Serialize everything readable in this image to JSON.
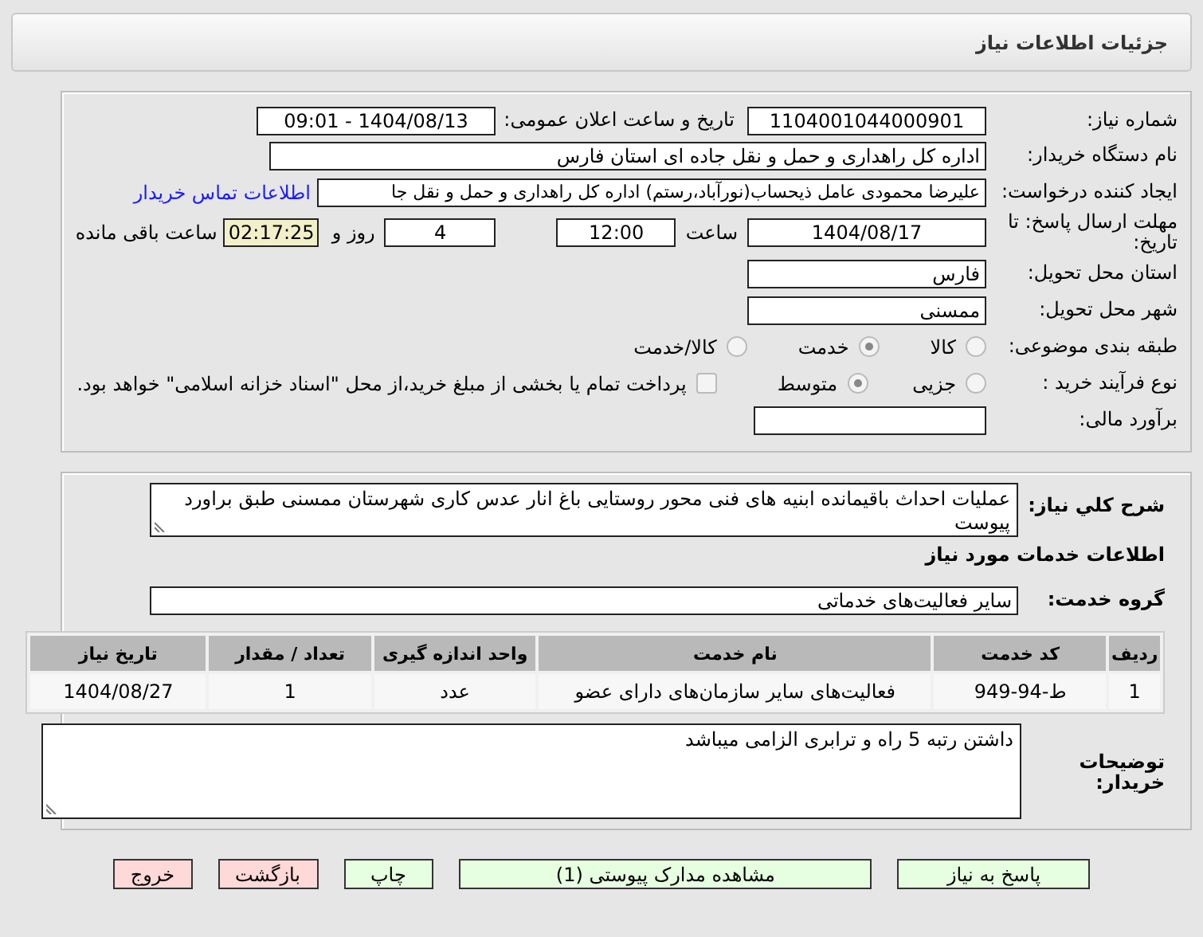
{
  "header": {
    "title": "جزئیات اطلاعات نیاز"
  },
  "details": {
    "need_number": {
      "label": "شماره نیاز:",
      "value": "1104001044000901"
    },
    "announce": {
      "label": "تاریخ و ساعت اعلان عمومی:",
      "value": "1404/08/13 - 09:01"
    },
    "buyer_org": {
      "label": "نام دستگاه خریدار:",
      "value": "اداره کل راهداری و حمل و نقل جاده ای استان فارس"
    },
    "requester": {
      "label": "ایجاد کننده درخواست:",
      "value": "علیرضا محمودی عامل ذیحساب(نورآباد،رستم) اداره کل راهداری و حمل و نقل جا",
      "link": "اطلاعات تماس خریدار"
    },
    "deadline": {
      "label": "مهلت ارسال پاسخ: تا تاریخ:",
      "date": "1404/08/17",
      "time_label": "ساعت",
      "time": "12:00",
      "days": "4",
      "days_label": "روز و",
      "remaining": "02:17:25",
      "remaining_label": "ساعت باقی مانده"
    },
    "province": {
      "label": "استان محل تحویل:",
      "value": "فارس"
    },
    "city": {
      "label": "شهر محل تحویل:",
      "value": "ممسنی"
    },
    "category": {
      "label": "طبقه بندی موضوعی:",
      "options": [
        {
          "label": "کالا",
          "selected": false
        },
        {
          "label": "خدمت",
          "selected": true
        },
        {
          "label": "کالا/خدمت",
          "selected": false
        }
      ]
    },
    "process": {
      "label": "نوع فرآیند خرید :",
      "options": [
        {
          "label": "جزیی",
          "selected": false
        },
        {
          "label": "متوسط",
          "selected": true
        }
      ],
      "payment": {
        "label": "پرداخت تمام یا بخشی از مبلغ خرید،از محل \"اسناد خزانه اسلامی\" خواهد بود.",
        "checked": false
      }
    },
    "budget": {
      "label": "برآورد مالی:"
    }
  },
  "description": {
    "label": "شرح کلي نياز:",
    "value": "عملیات احداث باقیمانده ابنیه های فنی محور روستایی باغ انار عدس کاری شهرستان ممسنی طبق براورد پیوست"
  },
  "services_title": "اطلاعات خدمات مورد نیاز",
  "service_group": {
    "label": "گروه خدمت:",
    "value": "سایر فعالیت‌های خدماتی"
  },
  "table": {
    "columns": [
      "ردیف",
      "کد خدمت",
      "نام خدمت",
      "واحد اندازه گیری",
      "تعداد / مقدار",
      "تاریخ نیاز"
    ],
    "rows": [
      [
        "1",
        "ط-94-949",
        "فعالیت‌های سایر سازمان‌های دارای عضو",
        "عدد",
        "1",
        "1404/08/27"
      ]
    ]
  },
  "buyer_notes": {
    "label": "توضیحات خریدار:",
    "value": "داشتن رتبه 5 راه و ترابری الزامی میباشد"
  },
  "buttons": [
    {
      "label": "پاسخ به نیاز",
      "kind": "normal"
    },
    {
      "label": "مشاهده مدارک پیوستی (1)",
      "kind": "normal"
    },
    {
      "label": "چاپ",
      "kind": "normal"
    },
    {
      "label": "بازگشت",
      "kind": "danger"
    },
    {
      "label": "خروج",
      "kind": "danger"
    }
  ]
}
